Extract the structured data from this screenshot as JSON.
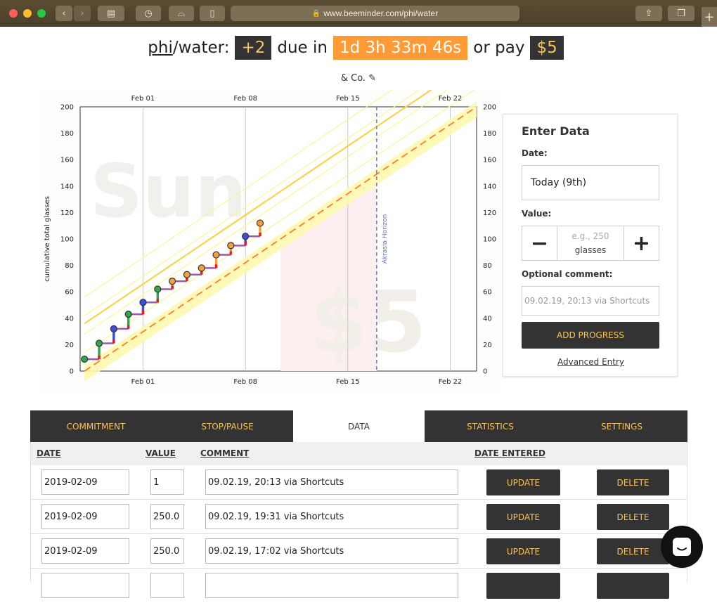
{
  "browser": {
    "url": "www.beeminder.com/phi/water"
  },
  "headline": {
    "user": "phi",
    "goal": "/water:",
    "delta": "+2",
    "due_label": "due in",
    "countdown": "1d 3h 33m 46s",
    "pay_label": "or pay",
    "pledge": "$5",
    "co": "& Co."
  },
  "chart_data": {
    "type": "line",
    "xlabel": "",
    "ylabel": "cumulative total glasses",
    "x_tick_labels": [
      "Feb 01",
      "Feb 08",
      "Feb 15",
      "Feb 22"
    ],
    "y_tick_labels": [
      "0",
      "20",
      "40",
      "60",
      "80",
      "100",
      "120",
      "140",
      "160",
      "180",
      "200"
    ],
    "ylim": [
      0,
      200
    ],
    "xlim_days": [
      -4.3,
      22.8
    ],
    "grid": true,
    "watermark_day": "Sun",
    "watermark_pledge": "$5",
    "horizon_label": "Akrasia Horizon",
    "horizon_day": 15.97,
    "today_day": 9,
    "road": {
      "day_start": -4,
      "value_start": 0,
      "day_end": 22.8,
      "value_end": 200
    },
    "datapoints": [
      {
        "day": -4,
        "value": 9,
        "color": "green"
      },
      {
        "day": -3,
        "value": 21,
        "color": "green"
      },
      {
        "day": -2,
        "value": 32,
        "color": "blue"
      },
      {
        "day": -1,
        "value": 43,
        "color": "green"
      },
      {
        "day": 0,
        "value": 52,
        "color": "blue"
      },
      {
        "day": 1,
        "value": 62,
        "color": "green"
      },
      {
        "day": 2,
        "value": 68,
        "color": "orange"
      },
      {
        "day": 3,
        "value": 73,
        "color": "orange"
      },
      {
        "day": 4,
        "value": 78,
        "color": "orange"
      },
      {
        "day": 5,
        "value": 88,
        "color": "orange"
      },
      {
        "day": 6,
        "value": 95,
        "color": "orange"
      },
      {
        "day": 7,
        "value": 102,
        "color": "blue"
      },
      {
        "day": 8,
        "value": 112,
        "color": "orange"
      }
    ]
  },
  "panel": {
    "title": "Enter Data",
    "date_label": "Date:",
    "date_value": "Today (9th)",
    "value_label": "Value:",
    "value_placeholder": "e.g., 250",
    "unit": "glasses",
    "minus": "−",
    "plus": "+",
    "comment_label": "Optional comment:",
    "comment_placeholder": "09.02.19, 20:13 via Shortcuts",
    "add_button": "ADD PROGRESS",
    "advanced_link": "Advanced Entry"
  },
  "tabs": [
    "COMMITMENT",
    "STOP/PAUSE",
    "DATA",
    "STATISTICS",
    "SETTINGS"
  ],
  "table": {
    "headers": [
      "DATE",
      "VALUE",
      "COMMENT",
      "DATE ENTERED"
    ],
    "update_label": "UPDATE",
    "delete_label": "DELETE",
    "rows": [
      {
        "date": "2019-02-09",
        "value": "1",
        "comment": "09.02.19, 20:13 via Shortcuts"
      },
      {
        "date": "2019-02-09",
        "value": "250.0",
        "comment": "09.02.19, 19:31 via Shortcuts"
      },
      {
        "date": "2019-02-09",
        "value": "250.0",
        "comment": "09.02.19, 17:02 via Shortcuts"
      }
    ]
  },
  "colors": {
    "accent": "#f7c35d",
    "dark": "#333333",
    "countdown_bg": "#ff9a35",
    "road": "#fff49a",
    "road_dash": "#ff7a32"
  }
}
